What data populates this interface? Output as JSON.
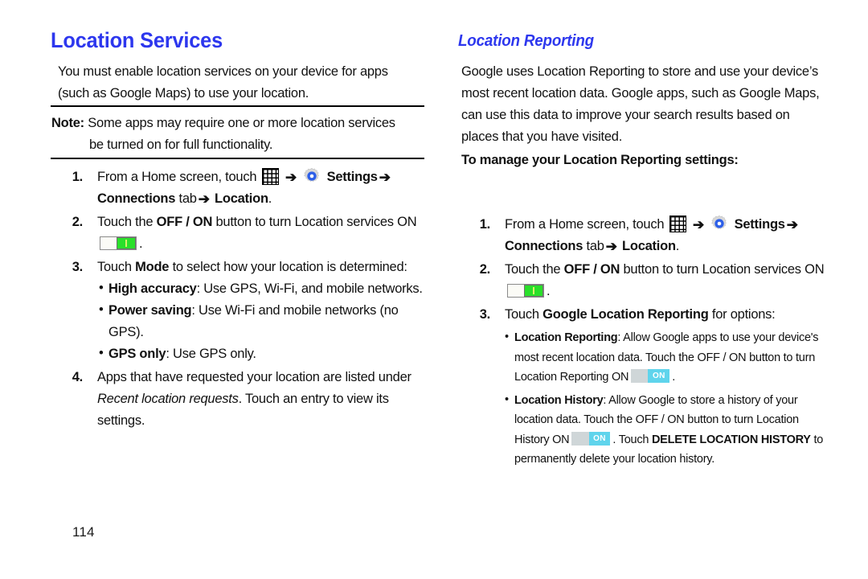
{
  "page": {
    "number": "114",
    "heading_color": "#2d37ee"
  },
  "left_column": {
    "title": "Location Services",
    "intro": "You must enable location services on your device for apps (such as Google Maps) to use your location.",
    "note": {
      "label": "Note:",
      "line1": "Some apps may require one or more location services",
      "line2": "be turned on for full functionality."
    },
    "steps": [
      {
        "num": "1.",
        "text_1": "From a Home screen, touch",
        "icon_apps": "apps-grid-icon",
        "arrow_1": "➔",
        "icon_gear": "settings-gear-icon",
        "bold_1": "Settings",
        "arrow_2": "➔",
        "bold_2": "Connections",
        "text_2": "tab",
        "arrow_3": "➔",
        "bold_3": "Location",
        "text_3": "."
      },
      {
        "num": "2.",
        "text_1": "Touch the",
        "bold_1": "OFF / ON",
        "text_2": "button to turn Location services ON",
        "toggle": "green-on-toggle",
        "text_3": "."
      },
      {
        "num": "3.",
        "text_1": "Touch",
        "bold_1": "Mode",
        "text_2": "to select how your location is determined:",
        "bullets": [
          {
            "label": "High accuracy",
            "text": ": Use GPS, Wi-Fi, and mobile networks."
          },
          {
            "label": "Power saving",
            "text": ": Use Wi-Fi and mobile networks (no GPS)."
          },
          {
            "label": "GPS only",
            "text": ": Use GPS only."
          }
        ]
      },
      {
        "num": "4.",
        "text_1": "Apps that have requested your location are listed under",
        "italic_1": "Recent location requests",
        "text_2": ". Touch an entry to view its settings."
      }
    ]
  },
  "right_column": {
    "title": "Location Reporting",
    "intro": "Google uses Location Reporting to store and use your device’s most recent location data. Google apps, such as Google Maps, can use this data to improve your search results based on places that you have visited.",
    "subheading": "To manage your Location Reporting settings:",
    "steps": [
      {
        "num": "1.",
        "text_1": "From a Home screen, touch",
        "icon_apps": "apps-grid-icon",
        "arrow_1": "➔",
        "icon_gear": "settings-gear-icon",
        "bold_1": "Settings",
        "arrow_2": "➔",
        "bold_2": "Connections",
        "text_2": "tab",
        "arrow_3": "➔",
        "bold_3": "Location",
        "text_3": "."
      },
      {
        "num": "2.",
        "text_1": "Touch the",
        "bold_1": "OFF / ON",
        "text_2": "button to turn Location services ON",
        "toggle": "green-on-toggle",
        "text_3": "."
      },
      {
        "num": "3.",
        "text_1": "Touch",
        "bold_1": "Google Location Reporting",
        "text_2": "for options:",
        "bullets": [
          {
            "label": "Location Reporting",
            "text_1": ": Allow Google apps to use your device's most recent location data. Touch the OFF / ON button to turn Location Reporting ON",
            "toggle": "cyan-on-toggle",
            "toggle_label": "ON",
            "text_2": "."
          },
          {
            "label": "Location History",
            "text_1": ": Allow Google to store a history of your location data. Touch the OFF / ON button to turn Location History ON",
            "toggle": "cyan-on-toggle",
            "toggle_label": "ON",
            "text_2": ". Touch",
            "bold_1": "DELETE LOCATION HISTORY",
            "text_3": "to permanently delete your location history."
          }
        ]
      }
    ]
  }
}
